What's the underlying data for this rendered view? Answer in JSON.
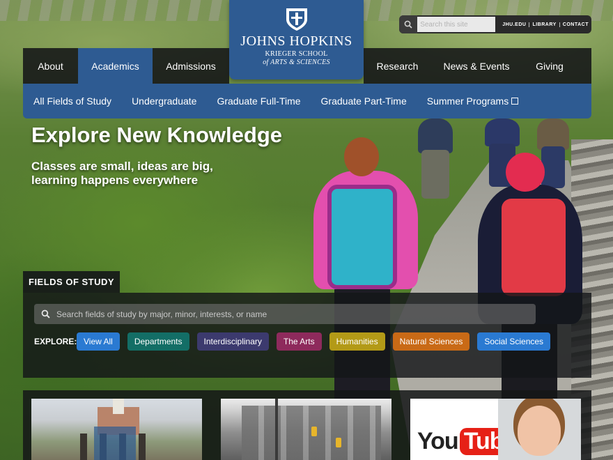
{
  "logo": {
    "university": "JOHNS HOPKINS",
    "school_line1": "KRIEGER SCHOOL",
    "school_line2": "of ARTS & SCIENCES"
  },
  "utility": {
    "search_placeholder": "Search this site",
    "links": [
      "JHU.EDU",
      "LIBRARY",
      "CONTACT"
    ]
  },
  "mainnav": {
    "items": [
      "About",
      "Academics",
      "Admissions",
      "Research",
      "News & Events",
      "Giving"
    ],
    "active": "Academics"
  },
  "subnav": {
    "items": [
      "All Fields of Study",
      "Undergraduate",
      "Graduate Full-Time",
      "Graduate Part-Time",
      "Summer Programs"
    ],
    "external_icon": "external-link-icon"
  },
  "hero": {
    "title": "Explore New Knowledge",
    "subtitle": "Classes are small, ideas are big, learning happens everywhere"
  },
  "fields_of_study": {
    "heading": "FIELDS OF STUDY",
    "search_placeholder": "Search fields of study by major, minor, interests, or name",
    "explore_label": "EXPLORE:",
    "filters": [
      {
        "label": "View All",
        "color": "#2a7ad2"
      },
      {
        "label": "Departments",
        "color": "#136e66"
      },
      {
        "label": "Interdisciplinary",
        "color": "#3c3a6e"
      },
      {
        "label": "The Arts",
        "color": "#8e2a5c"
      },
      {
        "label": "Humanities",
        "color": "#b39a17"
      },
      {
        "label": "Natural Sciences",
        "color": "#c96a16"
      },
      {
        "label": "Social Sciences",
        "color": "#2a7ad2"
      }
    ]
  },
  "cards": {
    "youtube_logo": "YouTube"
  },
  "colors": {
    "brand_blue": "#2e5b92",
    "nav_dark": "#141618"
  }
}
